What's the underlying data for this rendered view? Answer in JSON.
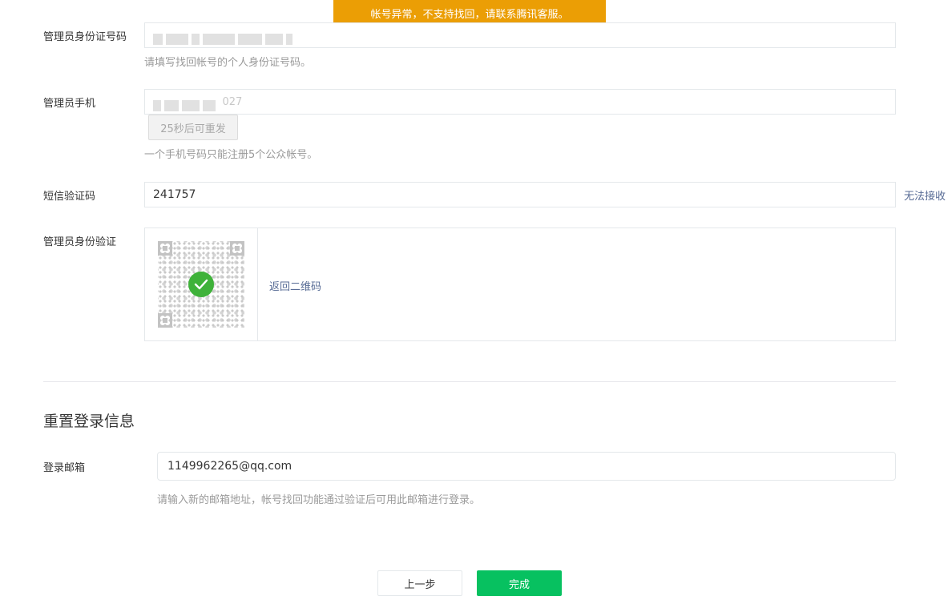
{
  "toast": {
    "text": "帐号异常，不支持找回，请联系腾讯客服。",
    "color": "#eb9e05"
  },
  "id_card": {
    "label": "管理员身份证号码",
    "tip": "请填写找回帐号的个人身份证号码。"
  },
  "phone": {
    "label": "管理员手机",
    "visible_suffix": "027",
    "resend_label": "25秒后可重发",
    "tip": "一个手机号码只能注册5个公众帐号。"
  },
  "sms": {
    "label": "短信验证码",
    "value": "241757",
    "cannot_receive_link": "无法接收"
  },
  "identity": {
    "label": "管理员身份验证",
    "back_to_qr_link": "返回二维码",
    "status_color": "#3fb23a"
  },
  "reset_section": {
    "title": "重置登录信息",
    "email_label": "登录邮箱",
    "email_value": "1149962265@qq.com",
    "email_tip": "请输入新的邮箱地址，帐号找回功能通过验证后可用此邮箱进行登录。"
  },
  "buttons": {
    "prev_label": "上一步",
    "done_label": "完成",
    "done_color": "#07c160"
  }
}
